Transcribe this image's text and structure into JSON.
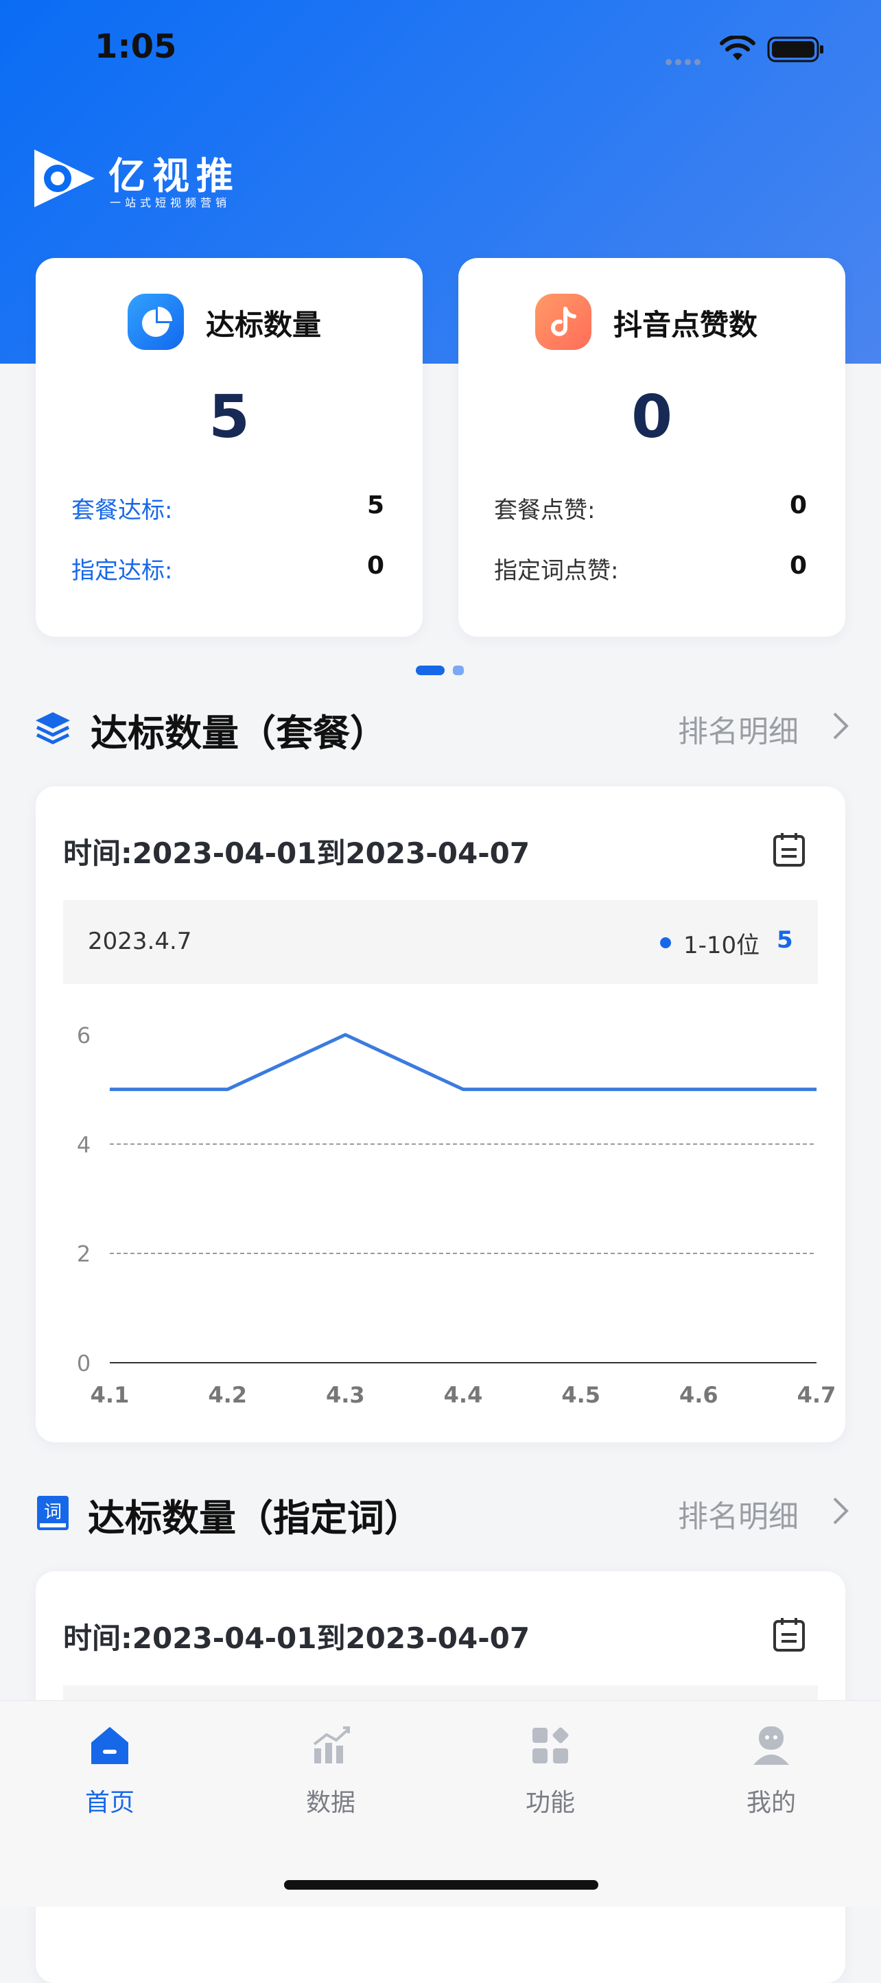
{
  "status": {
    "time": "1:05"
  },
  "brand": {
    "name": "亿视推",
    "tagline": "一站式短视频营销"
  },
  "stats": [
    {
      "title": "达标数量",
      "value": "5",
      "icon": "pie-chart-icon",
      "accent": "#1c78f0",
      "rows": [
        {
          "label": "套餐达标:",
          "value": "5"
        },
        {
          "label": "指定达标:",
          "value": "0"
        }
      ]
    },
    {
      "title": "抖音点赞数",
      "value": "0",
      "icon": "douyin-icon",
      "accent": "#ff7a5c",
      "rows": [
        {
          "label": "套餐点赞:",
          "value": "0"
        },
        {
          "label": "指定词点赞:",
          "value": "0"
        }
      ]
    }
  ],
  "section1": {
    "title": "达标数量（套餐）",
    "link": "排名明细",
    "time_range": "时间:2023-04-01到2023-04-07",
    "tooltip": {
      "date": "2023.4.7",
      "series": "1-10位",
      "value": "5"
    }
  },
  "section2": {
    "title": "达标数量（指定词）",
    "link": "排名明细",
    "time_range": "时间:2023-04-01到2023-04-07"
  },
  "chart_data": {
    "type": "line",
    "categories": [
      "4.1",
      "4.2",
      "4.3",
      "4.4",
      "4.5",
      "4.6",
      "4.7"
    ],
    "series": [
      {
        "name": "1-10位",
        "values": [
          5,
          5,
          6,
          5,
          5,
          5,
          5
        ]
      }
    ],
    "yticks": [
      0,
      2,
      4,
      6
    ],
    "ylim": [
      0,
      6
    ],
    "grid": true,
    "color": "#3a7be0"
  },
  "tabs": [
    {
      "label": "首页",
      "icon": "home-icon",
      "active": true
    },
    {
      "label": "数据",
      "icon": "chart-icon",
      "active": false
    },
    {
      "label": "功能",
      "icon": "apps-icon",
      "active": false
    },
    {
      "label": "我的",
      "icon": "profile-icon",
      "active": false
    }
  ],
  "colors": {
    "primary": "#1768e8",
    "header": "#0a6cf4"
  }
}
